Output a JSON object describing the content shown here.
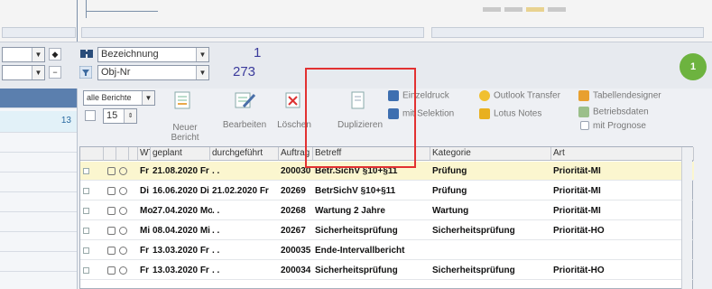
{
  "toolbar": {
    "field1_value": "Bezeichnung",
    "field2_value": "Obj-Nr",
    "count_top": "1",
    "count_bottom": "273",
    "green_badge": "1"
  },
  "left_panel": {
    "selected_value": "13"
  },
  "filter": {
    "report_select": "alle Berichte",
    "spin_value": "15"
  },
  "actions": {
    "new_report": "Neuer Bericht",
    "edit": "Bearbeiten",
    "delete": "Löschen",
    "duplicate": "Duplizieren",
    "single_print": "Einzeldruck",
    "with_selection": "mit Selektion",
    "outlook_transfer": "Outlook Transfer",
    "lotus_notes": "Lotus Notes",
    "table_designer": "Tabellendesigner",
    "operating_data": "Betriebsdaten",
    "with_forecast": "mit Prognose"
  },
  "grid": {
    "columns": [
      "WT",
      "geplant",
      "durchgeführt",
      "Auftrag",
      "Betreff",
      "Kategorie",
      "Art"
    ],
    "rows": [
      {
        "wt": "Fr",
        "planned": "21.08.2020 Fr",
        "done": ". .",
        "order": "200030",
        "subject": "Betr.SichV §10+§11",
        "category": "Prüfung",
        "type": "Priorität-MI"
      },
      {
        "wt": "Di",
        "planned": "16.06.2020 Di",
        "done": "21.02.2020 Fr",
        "order": "20269",
        "subject": "BetrSichV §10+§11",
        "category": "Prüfung",
        "type": "Priorität-MI"
      },
      {
        "wt": "Mo",
        "planned": "27.04.2020 Mo",
        "done": ". .",
        "order": "20268",
        "subject": "Wartung 2 Jahre",
        "category": "Wartung",
        "type": "Priorität-MI"
      },
      {
        "wt": "Mi",
        "planned": "08.04.2020 Mi",
        "done": ". .",
        "order": "20267",
        "subject": "Sicherheitsprüfung",
        "category": "Sicherheitsprüfung",
        "type": "Priorität-HO"
      },
      {
        "wt": "Fr",
        "planned": "13.03.2020 Fr",
        "done": ". .",
        "order": "200035",
        "subject": "Ende-Intervallbericht",
        "category": "",
        "type": ""
      },
      {
        "wt": "Fr",
        "planned": "13.03.2020 Fr",
        "done": ". .",
        "order": "200034",
        "subject": "Sicherheitsprüfung",
        "category": "Sicherheitsprüfung",
        "type": "Priorität-HO"
      }
    ]
  },
  "colors": {
    "highlight_box": "#e23131",
    "row_highlight": "#fbf6cf",
    "left_blue": "#5b7fae",
    "green_badge": "#6db33f"
  }
}
